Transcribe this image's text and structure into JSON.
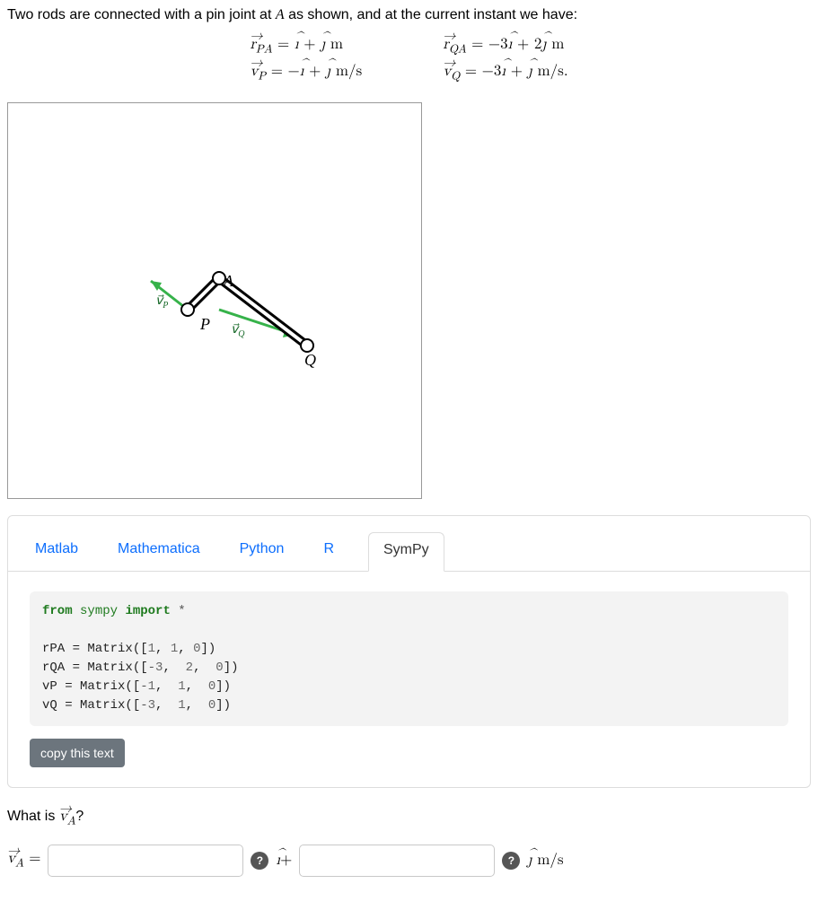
{
  "problem": {
    "intro_prefix": "Two rods are connected with a pin joint at ",
    "intro_point": "A",
    "intro_suffix": " as shown, and at the current instant we have:"
  },
  "equations": {
    "rPA": "r⃗_{PA} = î + ĵ m",
    "vP": "v⃗_{P} = -î + ĵ m/s",
    "rQA": "r⃗_{QA} = -3î + 2ĵ m",
    "vQ": "v⃗_{Q} = -3î + ĵ m/s."
  },
  "figure": {
    "labels": {
      "P": "P",
      "A": "A",
      "Q": "Q",
      "vP": "v⃗P",
      "vQ": "v⃗Q"
    }
  },
  "tabs": [
    "Matlab",
    "Mathematica",
    "Python",
    "R",
    "SymPy"
  ],
  "active_tab": "SymPy",
  "code": {
    "import_kw1": "from",
    "import_mod": "sympy",
    "import_kw2": "import",
    "import_star": "*",
    "l1": "rPA = Matrix([1, 1, 0])",
    "l2": "rQA = Matrix([-3,  2,  0])",
    "l3": "vP = Matrix([-1,  1,  0])",
    "l4": "vQ = Matrix([-3,  1,  0])"
  },
  "copy_button": "copy this text",
  "question": {
    "prefix": "What is ",
    "var": "v⃗_A",
    "suffix": "?"
  },
  "answer": {
    "lhs": "v⃗_A =",
    "i_input": "",
    "middle": "î+",
    "j_input": "",
    "unit": "ĵ m/s",
    "help": "?"
  },
  "chart_data": {
    "type": "diagram",
    "points": {
      "P": [
        0,
        0
      ],
      "A": [
        1,
        1
      ],
      "Q": [
        4,
        -1
      ]
    },
    "rods": [
      [
        "P",
        "A"
      ],
      [
        "A",
        "Q"
      ]
    ],
    "velocity_vectors": {
      "vP": {
        "at": "P",
        "dir": [
          -1,
          1
        ]
      },
      "vQ": {
        "at": "Q",
        "dir": [
          -3,
          1
        ]
      }
    },
    "given": {
      "rPA": [
        1,
        1
      ],
      "rQA": [
        -3,
        2
      ],
      "vP": [
        -1,
        1
      ],
      "vQ": [
        -3,
        1
      ]
    }
  }
}
